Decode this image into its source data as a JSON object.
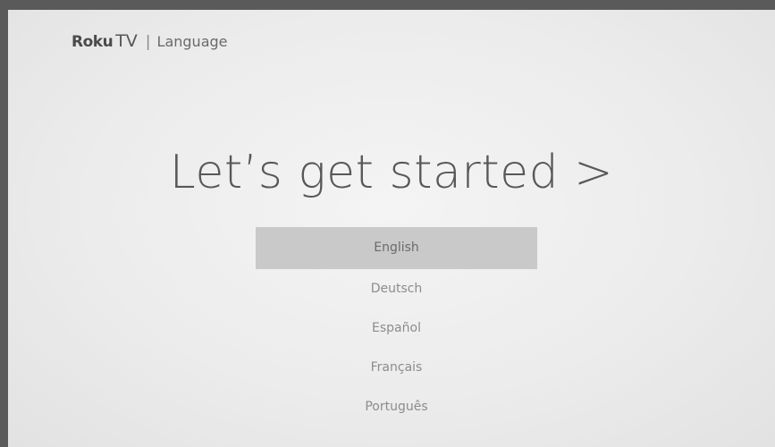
{
  "header": {
    "brand_roku": "Roku",
    "brand_tv": "TV",
    "separator": "|",
    "section": "Language"
  },
  "main": {
    "headline": "Let’s get started >"
  },
  "languages": {
    "selected_index": 0,
    "items": [
      "English",
      "Deutsch",
      "Español",
      "Français",
      "Português"
    ]
  },
  "colors": {
    "background": "#ececec",
    "selection": "#c9c9c9",
    "text": "#585858"
  }
}
